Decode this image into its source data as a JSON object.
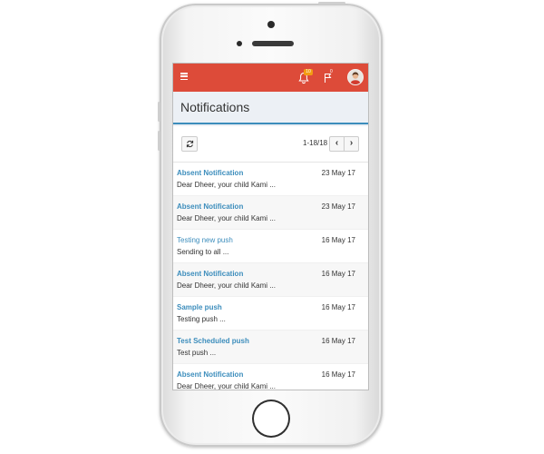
{
  "header": {
    "bell_count": "10",
    "flag_count": "0"
  },
  "page": {
    "title": "Notifications"
  },
  "toolbar": {
    "refresh_icon": "refresh-icon",
    "pagination": "1-18/18",
    "prev_label": "‹",
    "next_label": "›"
  },
  "notifications": [
    {
      "subject": "Absent Notification",
      "date": "23 May 17",
      "preview": "Dear Dheer, your child Kami ...",
      "read": false
    },
    {
      "subject": "Absent Notification",
      "date": "23 May 17",
      "preview": "Dear Dheer, your child Kami ...",
      "read": false
    },
    {
      "subject": "Testing new push",
      "date": "16 May 17",
      "preview": "Sending to all ...",
      "read": true
    },
    {
      "subject": "Absent Notification",
      "date": "16 May 17",
      "preview": "Dear Dheer, your child Kami ...",
      "read": false
    },
    {
      "subject": "Sample push",
      "date": "16 May 17",
      "preview": "Testing push ...",
      "read": false
    },
    {
      "subject": "Test Scheduled push",
      "date": "16 May 17",
      "preview": "Test push ...",
      "read": false
    },
    {
      "subject": "Absent Notification",
      "date": "16 May 17",
      "preview": "Dear Dheer, your child Kami ...",
      "read": false
    }
  ],
  "colors": {
    "topbar": "#dd4b39",
    "accent": "#3c8dbc",
    "badge": "#f39c12"
  }
}
